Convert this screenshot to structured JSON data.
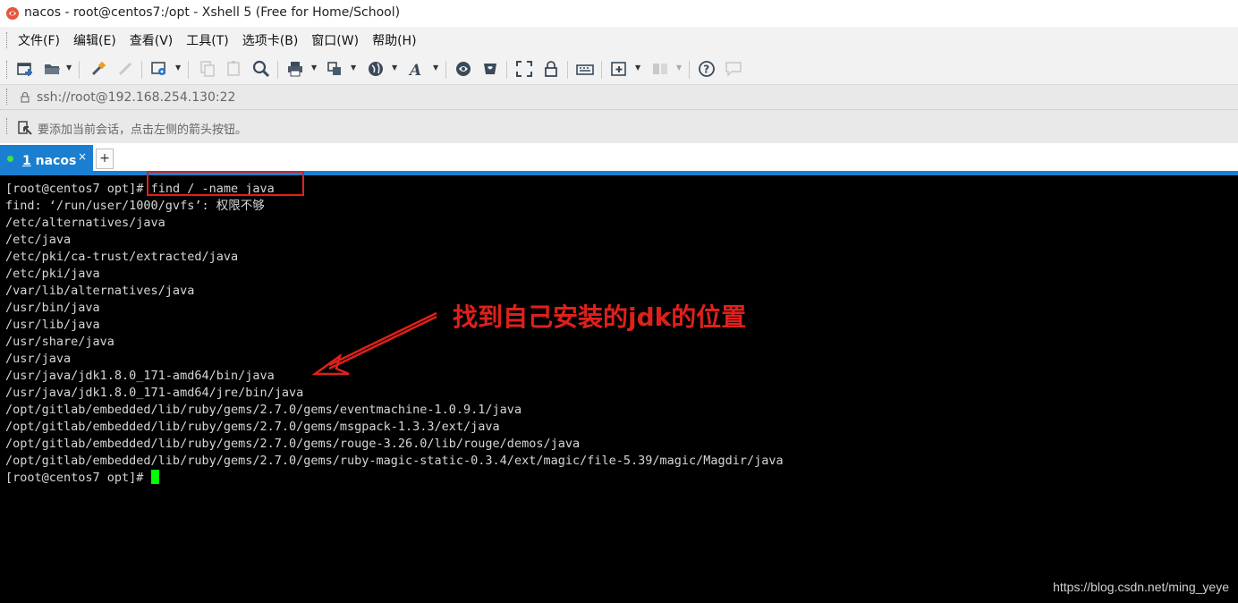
{
  "window": {
    "title": "nacos - root@centos7:/opt - Xshell 5 (Free for Home/School)"
  },
  "menu": [
    "文件(F)",
    "编辑(E)",
    "查看(V)",
    "工具(T)",
    "选项卡(B)",
    "窗口(W)",
    "帮助(H)"
  ],
  "address": {
    "text": "ssh://root@192.168.254.130:22"
  },
  "hint": {
    "text": "要添加当前会话，点击左侧的箭头按钮。"
  },
  "tab": {
    "index": "1",
    "name": "nacos",
    "close": "×",
    "new": "+"
  },
  "terminal": {
    "prompt": "[root@centos7 opt]",
    "command": "# find / -name java",
    "output": [
      "find: ‘/run/user/1000/gvfs’: 权限不够",
      "/etc/alternatives/java",
      "/etc/java",
      "/etc/pki/ca-trust/extracted/java",
      "/etc/pki/java",
      "/var/lib/alternatives/java",
      "/usr/bin/java",
      "/usr/lib/java",
      "/usr/share/java",
      "/usr/java",
      "/usr/java/jdk1.8.0_171-amd64/bin/java",
      "/usr/java/jdk1.8.0_171-amd64/jre/bin/java",
      "/opt/gitlab/embedded/lib/ruby/gems/2.7.0/gems/eventmachine-1.0.9.1/java",
      "/opt/gitlab/embedded/lib/ruby/gems/2.7.0/gems/msgpack-1.3.3/ext/java",
      "/opt/gitlab/embedded/lib/ruby/gems/2.7.0/gems/rouge-3.26.0/lib/rouge/demos/java",
      "/opt/gitlab/embedded/lib/ruby/gems/2.7.0/gems/ruby-magic-static-0.3.4/ext/magic/file-5.39/magic/Magdir/java"
    ],
    "final_prompt": "[root@centos7 opt]#"
  },
  "annotation": {
    "text": "找到自己安装的jdk的位置"
  },
  "watermark": {
    "text": "https://blog.csdn.net/ming_yeye"
  },
  "colors": {
    "accent": "#1a7fd0",
    "annotation": "#e0201b",
    "cursor": "#00ff00"
  }
}
